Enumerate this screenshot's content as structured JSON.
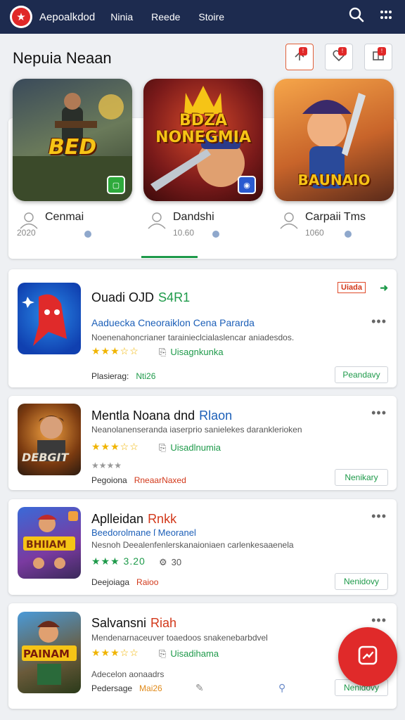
{
  "app": {
    "brand": "Aepoalkdod",
    "nav": [
      "Ninia",
      "Reede",
      "Stoire"
    ]
  },
  "section": {
    "title": "Nepuia Neaan",
    "header_buttons": [
      "share-icon",
      "heart-icon",
      "book-icon"
    ]
  },
  "featured": [
    {
      "art_text": "BED",
      "name": "Cenmai",
      "num": "2020"
    },
    {
      "art_text": "BDZA NONEGMIA",
      "name": "Dandshi",
      "num": "10.60"
    },
    {
      "art_text": "BAUNAIO",
      "name": "Carpaii Tms",
      "num": "1060"
    }
  ],
  "list": [
    {
      "title": "Ouadi OJD",
      "title_accent": "S4R1",
      "title_accent_color": "#1e9a4a",
      "subtitle": "Aaduecka Cneoraiklon Cena Pararda",
      "subtitle_color": "#1c5fb8",
      "desc": "Noenenahoncrianer tarainieclcialaslencar aniadesdos.",
      "stars": "★★★☆☆",
      "dev_label": "Uisagnkunka",
      "meta_label": "Plasierag:",
      "meta_value": "Nti26",
      "meta_value_color": "#1e9a4a",
      "action": "Peandavy",
      "badge": "Uiada"
    },
    {
      "title": "Mentla Noana dnd",
      "title_accent": "Rlaon",
      "title_accent_color": "#1c5fb8",
      "subtitle": "",
      "subtitle_color": "#333",
      "desc": "Neanolanenseranda iaserprio sanielekes daranklerioken",
      "stars": "★★★☆☆",
      "dev_label": "Uisadlnumia",
      "extra": "★★★★",
      "meta_label": "Pegoiona",
      "meta_value": "RneaarNaxed",
      "meta_value_color": "#d2381a",
      "action": "Nenikary"
    },
    {
      "title": "Aplleidan",
      "title_accent": "Rnkk",
      "title_accent_color": "#d2381a",
      "subtitle": "Beedorolmane ſ Meoranel",
      "subtitle_color": "#1c5fb8",
      "desc": "Nesnoh Deealenfenlerskanaioniaen carlenkesaaenela",
      "stars": "★★★ 3.20",
      "dev_label": "30",
      "meta_label": "Deejoiaga",
      "meta_value": "Raioo",
      "meta_value_color": "#d2381a",
      "action": "Nenidovy"
    },
    {
      "title": "Salvansni",
      "title_accent": "Riah",
      "title_accent_color": "#d2381a",
      "subtitle": "",
      "subtitle_color": "#333",
      "desc": "Mendenarnaceuver toaedoos snakenebarbdvel",
      "stars": "★★★☆☆",
      "dev_label": "Uisadihama",
      "extra": "Adecelon aonaadrs",
      "meta_label": "Pedersage",
      "meta_value": "Mai26",
      "meta_value_color": "#e08a1a",
      "action": "Nenidovy"
    }
  ]
}
